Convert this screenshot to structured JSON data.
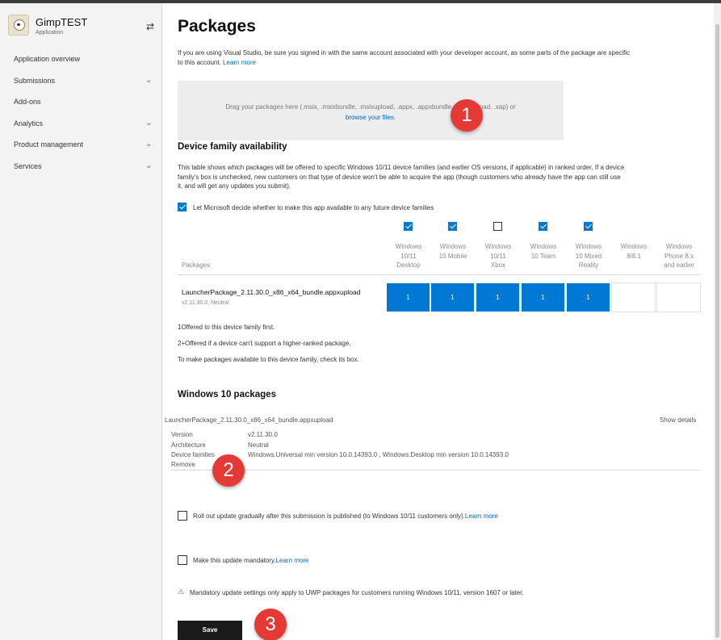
{
  "sidebar": {
    "app_title": "GimpTEST",
    "app_subtitle": "Application",
    "switch_icon": "⇄",
    "items": [
      {
        "label": "Application overview",
        "chevron": false
      },
      {
        "label": "Submissions",
        "chevron": true
      },
      {
        "label": "Add-ons",
        "chevron": false
      },
      {
        "label": "Analytics",
        "chevron": true
      },
      {
        "label": "Product management",
        "chevron": true
      },
      {
        "label": "Services",
        "chevron": true
      }
    ]
  },
  "page": {
    "title": "Packages",
    "intro_line1": "If you are using Visual Studio, be sure you signed in with the same account associated with your developer account, as some parts of the package are specific",
    "intro_line2": "to this account.",
    "learn_more": "Learn more",
    "drop_line1": "Drag your packages here (.msix, .msixbundle, .msixupload, .appx, .appxbundle, .appxupload, .xap) or",
    "drop_link": "browse your files."
  },
  "device_family": {
    "heading": "Device family availability",
    "desc_line1": "This table shows which packages will be offered to specific Windows 10/11 device families (and earlier OS versions, if applicable) in ranked order. If a device",
    "desc_line2": "family's box is unchecked, new customers on that type of device won't be able to acquire the app (though customers who already have the app can still use",
    "desc_line3": "it, and will get any updates you submit).",
    "let_ms_decide": "Let Microsoft decide whether to make this app available to any future device families",
    "packages_header": "Packages",
    "columns": [
      {
        "l1": "Windows",
        "l2": "10/11",
        "l3": "Desktop",
        "checked": true
      },
      {
        "l1": "Windows",
        "l2": "10 Mobile",
        "l3": "",
        "checked": true
      },
      {
        "l1": "Windows",
        "l2": "10/11",
        "l3": "Xbox",
        "checked": false
      },
      {
        "l1": "Windows",
        "l2": "10 Team",
        "l3": "",
        "checked": true
      },
      {
        "l1": "Windows",
        "l2": "10 Mixed",
        "l3": "Reality",
        "checked": true
      },
      {
        "l1": "Windows",
        "l2": "8/8.1",
        "l3": "",
        "checked": null
      },
      {
        "l1": "Windows",
        "l2": "Phone 8.x",
        "l3": "and earlier",
        "checked": null
      }
    ],
    "package_name": "LauncherPackage_2.11.30.0_x86_x64_bundle.appxupload",
    "package_version": "v2.11.30.0, Neutral",
    "cells": [
      "1",
      "1",
      "1",
      "1",
      "1",
      "",
      ""
    ],
    "note1": "1Offered to this device family first.",
    "note2": "2+Offered if a device can't support a higher-ranked package.",
    "note3": "To make packages available to this device family, check its box."
  },
  "win10": {
    "heading": "Windows 10 packages",
    "package_name": "LauncherPackage_2.11.30.0_x86_x64_bundle.appxupload",
    "show_details": "Show details",
    "version_label": "Version",
    "version_value": "v2.11.30.0",
    "arch_label": "Architecture",
    "arch_value": "Neutral",
    "families_label": "Device families",
    "families_value": "Windows.Universal min version 10.0.14393.0 , Windows.Desktop min version 10.0.14393.0",
    "remove": "Remove"
  },
  "options": {
    "rollout_text": "Roll out update gradually after this submission is published (to Windows 10/11 customers only).",
    "rollout_link": "Learn more",
    "mandatory_text": "Make this update mandatory.",
    "mandatory_link": "Learn more",
    "warning_icon": "⚠",
    "warning_text": "Mandatory update settings only apply to UWP packages for customers running Windows 10/11, version 1607 or later."
  },
  "save_label": "Save",
  "badges": [
    "1",
    "2",
    "3"
  ]
}
